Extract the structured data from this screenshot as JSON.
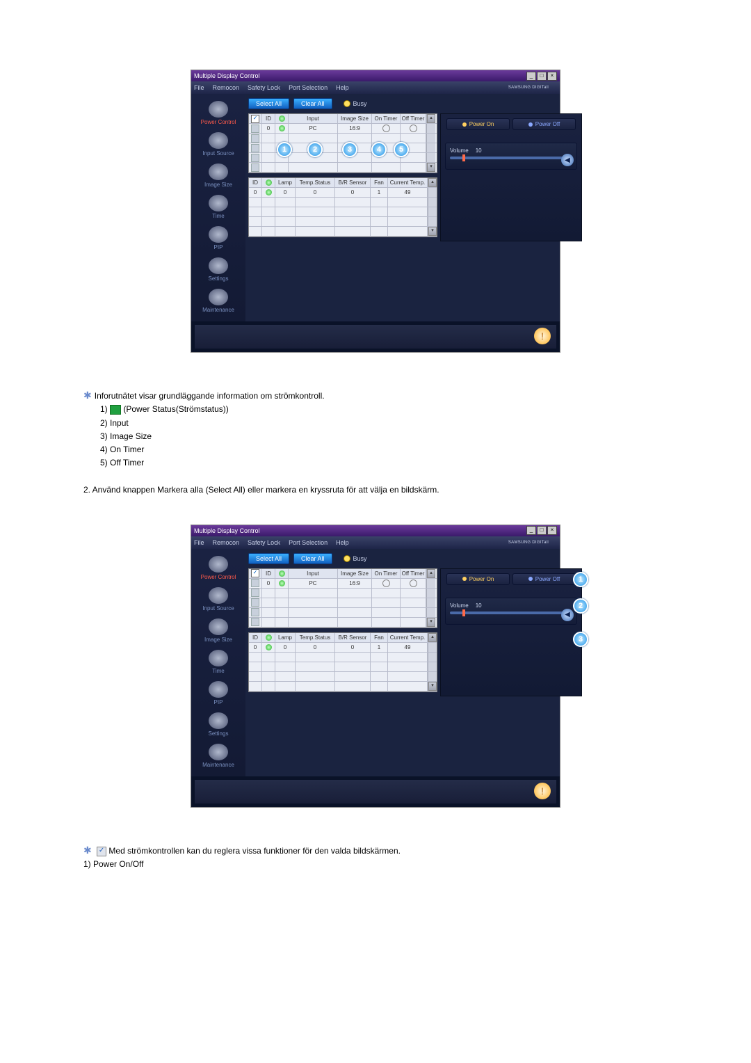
{
  "app_title": "Multiple Display Control",
  "menu": [
    "File",
    "Remocon",
    "Safety Lock",
    "Port Selection",
    "Help"
  ],
  "brand": "SAMSUNG DIGITall",
  "sidebar": [
    {
      "label": "Power Control",
      "key": "power-control"
    },
    {
      "label": "Input Source",
      "key": "input-source"
    },
    {
      "label": "Image Size",
      "key": "image-size"
    },
    {
      "label": "Time",
      "key": "time"
    },
    {
      "label": "PIP",
      "key": "pip"
    },
    {
      "label": "Settings",
      "key": "settings"
    },
    {
      "label": "Maintenance",
      "key": "maintenance"
    }
  ],
  "toolbar": {
    "select_all": "Select All",
    "clear_all": "Clear All",
    "busy": "Busy"
  },
  "grid1": {
    "headers": [
      "",
      "ID",
      "",
      "Input",
      "Image Size",
      "On Timer",
      "Off Timer"
    ],
    "row": {
      "id": "0",
      "input": "PC",
      "image_size": "16:9"
    }
  },
  "grid2": {
    "headers": [
      "ID",
      "",
      "Lamp",
      "Temp.Status",
      "B/R Sensor",
      "Fan",
      "Current Temp."
    ],
    "row": {
      "id": "0",
      "lamp": "0",
      "temp_status": "0",
      "br_sensor": "0",
      "fan": "1",
      "current_temp": "49"
    }
  },
  "panel": {
    "power_on": "Power On",
    "power_off": "Power Off",
    "volume_label": "Volume",
    "volume_value": "10"
  },
  "callouts_img1": [
    "1",
    "2",
    "3",
    "4",
    "5"
  ],
  "callouts_img2": [
    "1",
    "2",
    "3"
  ],
  "text1": {
    "intro": "Inforutnätet visar grundläggande information om strömkontroll.",
    "items": [
      "(Power Status(Strömstatus))",
      "Input",
      "Image Size",
      "On Timer",
      "Off Timer"
    ],
    "prefixes": [
      "1)",
      "2)",
      "3)",
      "4)",
      "5)"
    ],
    "step2": "2.  Använd knappen Markera alla (Select All) eller markera en kryssruta för att välja en bildskärm."
  },
  "text2": {
    "intro": "Med strömkontrollen kan du reglera vissa funktioner för den valda bildskärmen.",
    "item1": "1)  Power On/Off"
  }
}
